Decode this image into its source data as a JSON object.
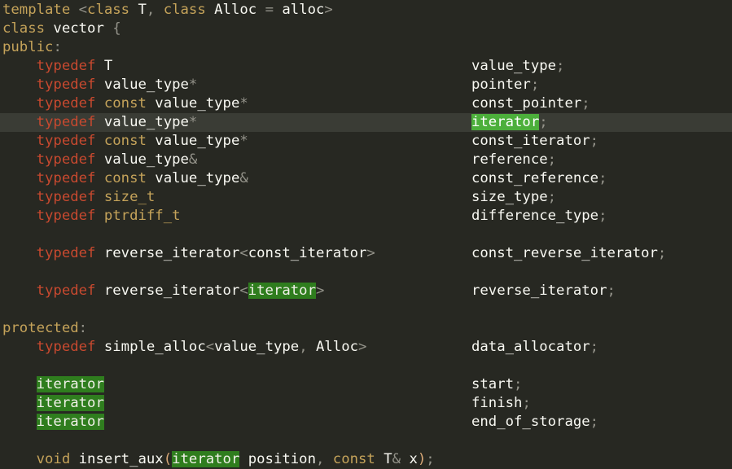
{
  "colors": {
    "background": "#272822",
    "current_line": "#3a3c35",
    "highlight": "#2f7d1e",
    "highlight_active": "#4caf3b",
    "keyword": "#c5a35a",
    "typedef": "#c7492f"
  },
  "lines": [
    {
      "left": [
        [
          "kw",
          "template"
        ],
        [
          "dim",
          " <"
        ],
        [
          "kw",
          "class"
        ],
        [
          "",
          " T"
        ],
        [
          "dim",
          ", "
        ],
        [
          "kw",
          "class"
        ],
        [
          "",
          " Alloc "
        ],
        [
          "dim",
          "="
        ],
        [
          "",
          " alloc"
        ],
        [
          "dim",
          ">"
        ]
      ],
      "right": []
    },
    {
      "left": [
        [
          "kw",
          "class"
        ],
        [
          "",
          " vector "
        ],
        [
          "dim",
          "{"
        ]
      ],
      "right": []
    },
    {
      "left": [
        [
          "kw",
          "public"
        ],
        [
          "dim",
          ":"
        ]
      ],
      "right": []
    },
    {
      "left": [
        [
          "",
          "    "
        ],
        [
          "ty",
          "typedef"
        ],
        [
          "",
          " T"
        ]
      ],
      "right": [
        [
          "",
          "value_type"
        ],
        [
          "dim",
          ";"
        ]
      ]
    },
    {
      "left": [
        [
          "",
          "    "
        ],
        [
          "ty",
          "typedef"
        ],
        [
          "",
          " value_type"
        ],
        [
          "dim",
          "*"
        ]
      ],
      "right": [
        [
          "",
          "pointer"
        ],
        [
          "dim",
          ";"
        ]
      ]
    },
    {
      "left": [
        [
          "",
          "    "
        ],
        [
          "ty",
          "typedef"
        ],
        [
          "kw",
          " const"
        ],
        [
          "",
          " value_type"
        ],
        [
          "dim",
          "*"
        ]
      ],
      "right": [
        [
          "",
          "const_pointer"
        ],
        [
          "dim",
          ";"
        ]
      ]
    },
    {
      "current": true,
      "left": [
        [
          "",
          "    "
        ],
        [
          "ty",
          "typedef"
        ],
        [
          "",
          " value_type"
        ],
        [
          "dim",
          "*"
        ]
      ],
      "right": [
        [
          "hl-bright",
          "iterator"
        ],
        [
          "dim",
          ";"
        ]
      ]
    },
    {
      "left": [
        [
          "",
          "    "
        ],
        [
          "ty",
          "typedef"
        ],
        [
          "kw",
          " const"
        ],
        [
          "",
          " value_type"
        ],
        [
          "dim",
          "*"
        ]
      ],
      "right": [
        [
          "",
          "const_iterator"
        ],
        [
          "dim",
          ";"
        ]
      ]
    },
    {
      "left": [
        [
          "",
          "    "
        ],
        [
          "ty",
          "typedef"
        ],
        [
          "",
          " value_type"
        ],
        [
          "dim",
          "&"
        ]
      ],
      "right": [
        [
          "",
          "reference"
        ],
        [
          "dim",
          ";"
        ]
      ]
    },
    {
      "left": [
        [
          "",
          "    "
        ],
        [
          "ty",
          "typedef"
        ],
        [
          "kw",
          " const"
        ],
        [
          "",
          " value_type"
        ],
        [
          "dim",
          "&"
        ]
      ],
      "right": [
        [
          "",
          "const_reference"
        ],
        [
          "dim",
          ";"
        ]
      ]
    },
    {
      "left": [
        [
          "",
          "    "
        ],
        [
          "ty",
          "typedef"
        ],
        [
          "kw",
          " size_t"
        ]
      ],
      "right": [
        [
          "",
          "size_type"
        ],
        [
          "dim",
          ";"
        ]
      ]
    },
    {
      "left": [
        [
          "",
          "    "
        ],
        [
          "ty",
          "typedef"
        ],
        [
          "kw",
          " ptrdiff_t"
        ]
      ],
      "right": [
        [
          "",
          "difference_type"
        ],
        [
          "dim",
          ";"
        ]
      ]
    },
    {
      "left": [],
      "right": []
    },
    {
      "left": [
        [
          "",
          "    "
        ],
        [
          "ty",
          "typedef"
        ],
        [
          "",
          " reverse_iterator"
        ],
        [
          "dim",
          "<"
        ],
        [
          "",
          "const_iterator"
        ],
        [
          "dim",
          ">"
        ]
      ],
      "right": [
        [
          "",
          "const_reverse_iterator"
        ],
        [
          "dim",
          ";"
        ]
      ]
    },
    {
      "left": [],
      "right": []
    },
    {
      "left": [
        [
          "",
          "    "
        ],
        [
          "ty",
          "typedef"
        ],
        [
          "",
          " reverse_iterator"
        ],
        [
          "dim",
          "<"
        ],
        [
          "hl",
          "iterator"
        ],
        [
          "dim",
          ">"
        ]
      ],
      "right": [
        [
          "",
          "reverse_iterator"
        ],
        [
          "dim",
          ";"
        ]
      ]
    },
    {
      "left": [],
      "right": []
    },
    {
      "left": [
        [
          "kw",
          "protected"
        ],
        [
          "dim",
          ":"
        ]
      ],
      "right": []
    },
    {
      "left": [
        [
          "",
          "    "
        ],
        [
          "ty",
          "typedef"
        ],
        [
          "",
          " simple_alloc"
        ],
        [
          "dim",
          "<"
        ],
        [
          "",
          "value_type"
        ],
        [
          "dim",
          ","
        ],
        [
          "",
          " Alloc"
        ],
        [
          "dim",
          ">"
        ]
      ],
      "right": [
        [
          "",
          "data_allocator"
        ],
        [
          "dim",
          ";"
        ]
      ]
    },
    {
      "left": [],
      "right": []
    },
    {
      "left": [
        [
          "",
          "    "
        ],
        [
          "hl",
          "iterator"
        ]
      ],
      "right": [
        [
          "",
          "start"
        ],
        [
          "dim",
          ";"
        ]
      ]
    },
    {
      "left": [
        [
          "",
          "    "
        ],
        [
          "hl",
          "iterator"
        ]
      ],
      "right": [
        [
          "",
          "finish"
        ],
        [
          "dim",
          ";"
        ]
      ]
    },
    {
      "left": [
        [
          "",
          "    "
        ],
        [
          "hl",
          "iterator"
        ]
      ],
      "right": [
        [
          "",
          "end_of_storage"
        ],
        [
          "dim",
          ";"
        ]
      ]
    },
    {
      "left": [],
      "right": []
    },
    {
      "left": [
        [
          "",
          "    "
        ],
        [
          "kw",
          "void"
        ],
        [
          "",
          " insert_aux"
        ],
        [
          "br",
          "("
        ],
        [
          "hl",
          "iterator"
        ],
        [
          "",
          " position"
        ],
        [
          "dim",
          ", "
        ],
        [
          "kw",
          "const"
        ],
        [
          "",
          " T"
        ],
        [
          "dim",
          "&"
        ],
        [
          "",
          " x"
        ],
        [
          "br",
          ")"
        ],
        [
          "dim",
          ";"
        ]
      ],
      "right": []
    }
  ]
}
